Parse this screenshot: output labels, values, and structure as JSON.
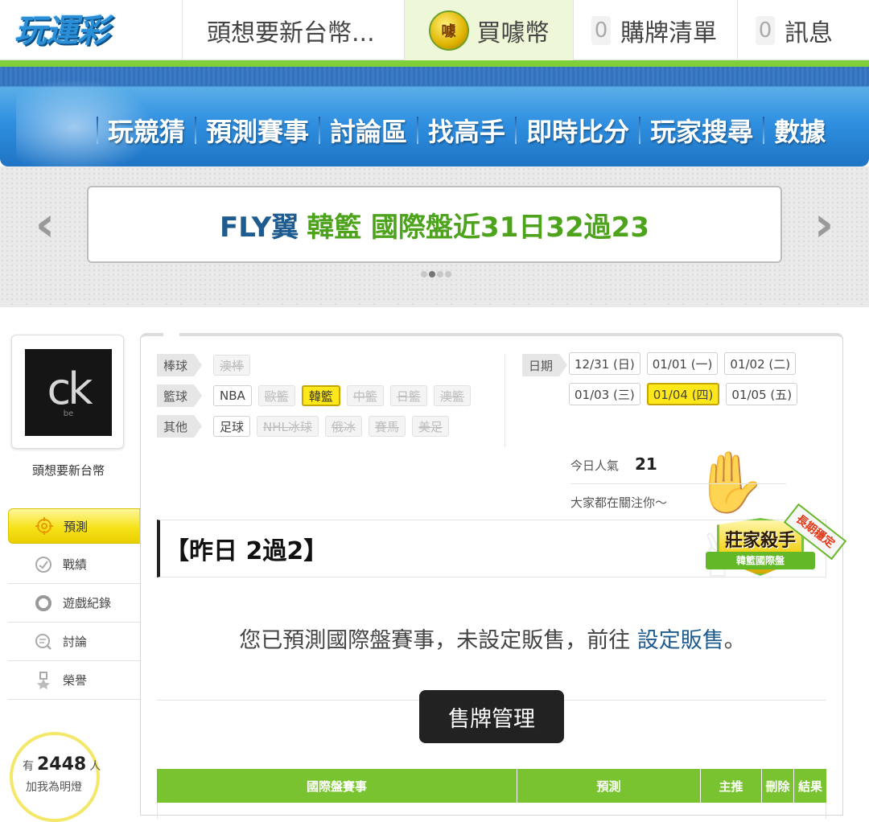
{
  "header": {
    "logo_text": "玩運彩",
    "username": "頭想要新台幣...",
    "buy_coin_icon_char": "噱",
    "buy_coin_label": "買噱幣",
    "cart_count": "0",
    "cart_label": "購牌清單",
    "messages_count": "0",
    "messages_label": "訊息"
  },
  "nav": {
    "items": [
      "玩競猜",
      "預測賽事",
      "討論區",
      "找高手",
      "即時比分",
      "玩家搜尋",
      "數據"
    ]
  },
  "banner": {
    "text_blue": "FLY翼",
    "text_green": "韓籃 國際盤近31日32過23",
    "prev_arrow": "‹",
    "next_arrow": "›"
  },
  "sidebar": {
    "avatar_text": "ck",
    "avatar_subtext": "be",
    "username": "頭想要新台幣",
    "menu": [
      {
        "label": "預測",
        "icon": "target-icon",
        "active": true
      },
      {
        "label": "戰績",
        "icon": "record-icon"
      },
      {
        "label": "遊戲紀錄",
        "icon": "circle-icon"
      },
      {
        "label": "討論",
        "icon": "discussion-icon"
      },
      {
        "label": "榮譽",
        "icon": "medal-icon"
      }
    ],
    "fans": {
      "prefix": "有",
      "count": "2448",
      "suffix": "人",
      "cta": "加我為明燈"
    }
  },
  "filters": {
    "baseball": {
      "label": "棒球",
      "items": [
        {
          "label": "澳棒",
          "enabled": false
        }
      ]
    },
    "basketball": {
      "label": "籃球",
      "items": [
        {
          "label": "NBA",
          "enabled": true
        },
        {
          "label": "歐籃",
          "enabled": false
        },
        {
          "label": "韓籃",
          "enabled": true,
          "selected": true
        },
        {
          "label": "中籃",
          "enabled": false
        },
        {
          "label": "日籃",
          "enabled": false
        },
        {
          "label": "澳籃",
          "enabled": false
        }
      ]
    },
    "other": {
      "label": "其他",
      "items": [
        {
          "label": "足球",
          "enabled": true
        },
        {
          "label": "NHL冰球",
          "enabled": false
        },
        {
          "label": "俄冰",
          "enabled": false
        },
        {
          "label": "賽馬",
          "enabled": false
        },
        {
          "label": "美足",
          "enabled": false
        }
      ]
    },
    "date": {
      "label": "日期",
      "items": [
        {
          "label": "12/31 (日)"
        },
        {
          "label": "01/01 (一)"
        },
        {
          "label": "01/02 (二)"
        },
        {
          "label": "01/03 (三)"
        },
        {
          "label": "01/04 (四)",
          "selected": true
        },
        {
          "label": "01/05 (五)"
        }
      ]
    }
  },
  "popularity": {
    "label": "今日人氣",
    "value": "21",
    "note": "大家都在關注你～"
  },
  "yesterday": {
    "title": "【昨日 2過2】"
  },
  "badge": {
    "title": "莊家殺手",
    "ribbon": "韓籃國際盤",
    "sash": "長期穩定"
  },
  "notice": {
    "text": "您已預測國際盤賽事，未設定販售，前往 ",
    "link": "設定販售",
    "end": "。"
  },
  "manage_button": "售牌管理",
  "table": {
    "headers": [
      "國際盤賽事",
      "預測",
      "主推",
      "刪除",
      "結果"
    ]
  },
  "colors": {
    "green": "#7fcf3a",
    "nav_blue": "#2f8fe0",
    "yellow": "#ffe81a",
    "link": "#1e5b8e"
  }
}
